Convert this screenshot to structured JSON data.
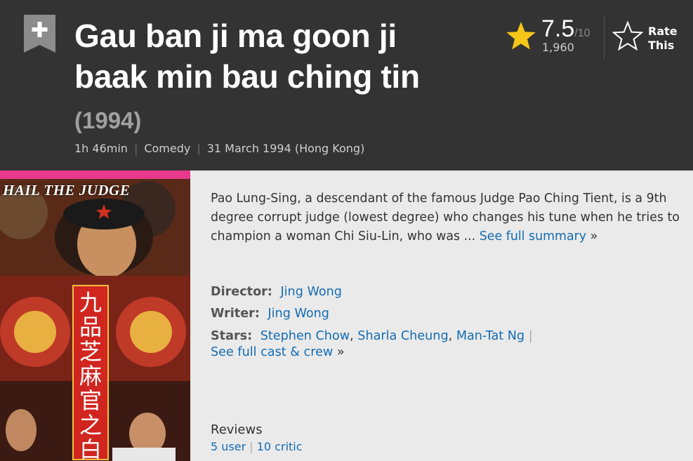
{
  "header": {
    "title": "Gau ban ji ma goon ji baak min bau ching tin",
    "year": "(1994)",
    "runtime": "1h 46min",
    "genre": "Comedy",
    "release_date": "31 March 1994 (Hong Kong)",
    "separator": "|"
  },
  "rating": {
    "value": "7.5",
    "best": "/10",
    "count": "1,960",
    "rate_label": "Rate This"
  },
  "poster": {
    "caption": "HAIL THE JUDGE",
    "chinese_title": "九品芝麻官之白面包青天"
  },
  "summary": {
    "text": "Pao Lung-Sing, a descendant of the famous Judge Pao Ching Tient, is a 9th degree corrupt judge (lowest degree) who changes his tune when he tries to champion a woman Chi Siu-Lin, who was ...",
    "see_full": "See full summary",
    "raquo": "»"
  },
  "credits": {
    "director_label": "Director:",
    "director": "Jing Wong",
    "writer_label": "Writer:",
    "writer": "Jing Wong",
    "stars_label": "Stars:",
    "stars": [
      "Stephen Chow",
      "Sharla Cheung",
      "Man-Tat Ng"
    ],
    "comma": ",",
    "pipe": "|",
    "full_cast": "See full cast & crew",
    "raquo": "»"
  },
  "reviews": {
    "title": "Reviews",
    "user": "5 user",
    "critic": "10 critic",
    "pipe": "|"
  },
  "colors": {
    "header_bg": "#333333",
    "link": "#136cb2",
    "star_gold": "#f5c518",
    "page_bg": "#eaeaea"
  }
}
